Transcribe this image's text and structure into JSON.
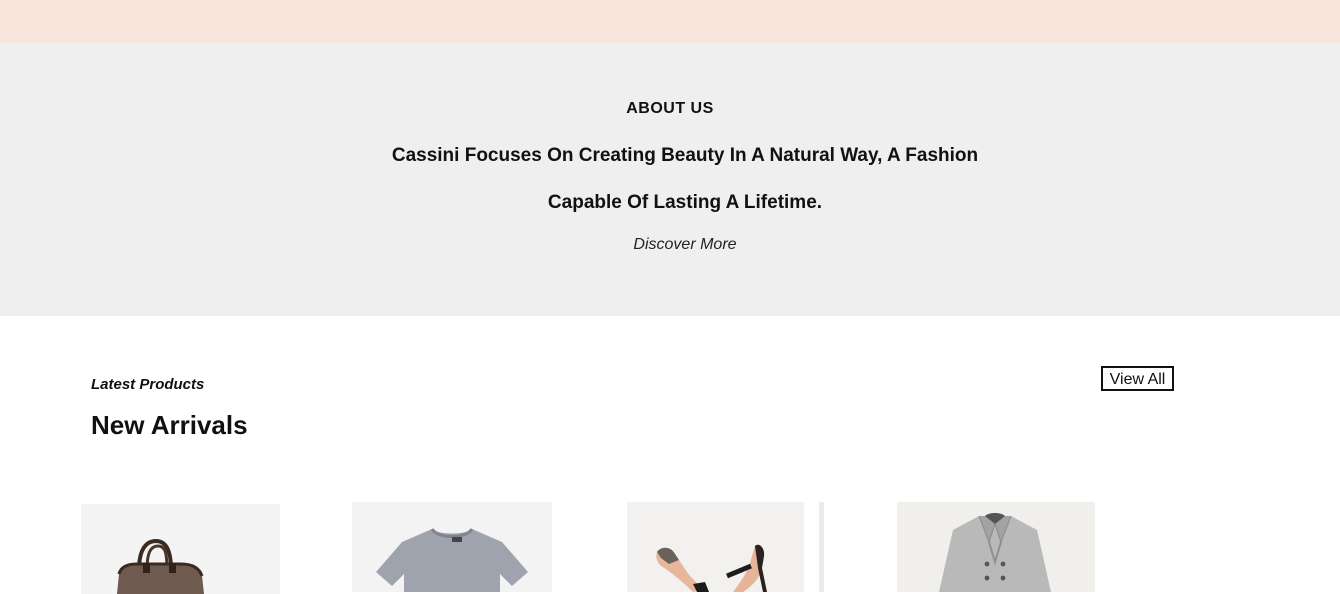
{
  "about": {
    "heading": "ABOUT US",
    "line1": "Cassini Focuses On Creating Beauty In A Natural Way, A Fashion",
    "line2": "Capable Of Lasting A Lifetime.",
    "discover_label": "Discover More"
  },
  "products": {
    "eyebrow": "Latest Products",
    "title": "New Arrivals",
    "view_all_label": "View All",
    "items": [
      {
        "icon": "bag-icon"
      },
      {
        "icon": "tshirt-icon"
      },
      {
        "icon": "heels-icon"
      },
      {
        "icon": "coat-icon"
      }
    ]
  },
  "colors": {
    "top_band": "#f7e4da",
    "about_bg": "#efefef"
  }
}
